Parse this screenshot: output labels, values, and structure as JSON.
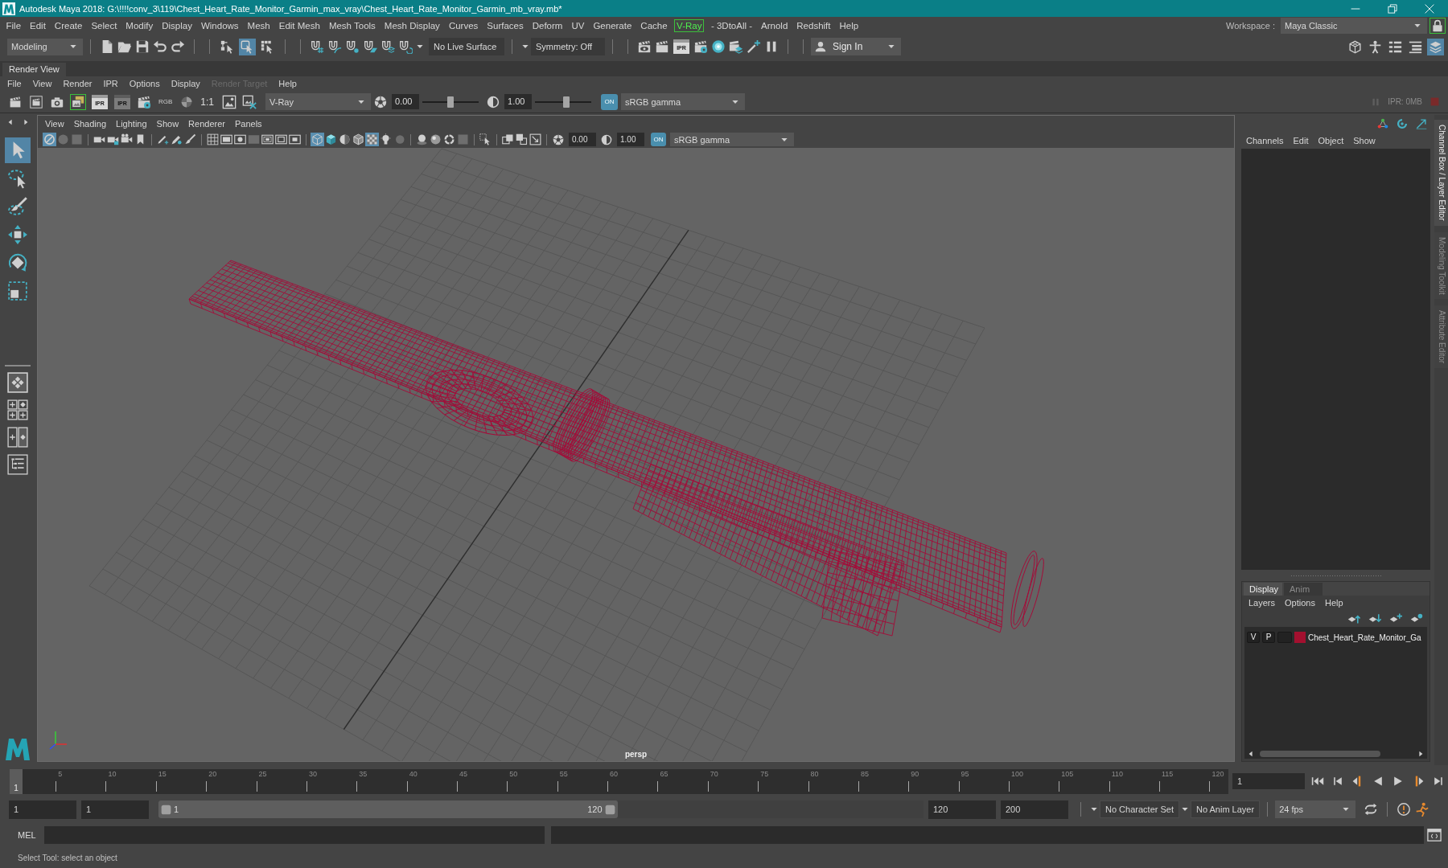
{
  "window": {
    "title": "Autodesk Maya 2018: G:\\!!!!conv_3\\119\\Chest_Heart_Rate_Monitor_Garmin_max_vray\\Chest_Heart_Rate_Monitor_Garmin_mb_vray.mb*"
  },
  "main_menu": [
    {
      "label": "File",
      "highlighted": false
    },
    {
      "label": "Edit",
      "highlighted": false
    },
    {
      "label": "Create",
      "highlighted": false
    },
    {
      "label": "Select",
      "highlighted": false
    },
    {
      "label": "Modify",
      "highlighted": false
    },
    {
      "label": "Display",
      "highlighted": false
    },
    {
      "label": "Windows",
      "highlighted": false
    },
    {
      "label": "Mesh",
      "highlighted": false
    },
    {
      "label": "Edit Mesh",
      "highlighted": false
    },
    {
      "label": "Mesh Tools",
      "highlighted": false
    },
    {
      "label": "Mesh Display",
      "highlighted": false
    },
    {
      "label": "Curves",
      "highlighted": false
    },
    {
      "label": "Surfaces",
      "highlighted": false
    },
    {
      "label": "Deform",
      "highlighted": false
    },
    {
      "label": "UV",
      "highlighted": false
    },
    {
      "label": "Generate",
      "highlighted": false
    },
    {
      "label": "Cache",
      "highlighted": false
    },
    {
      "label": "V-Ray",
      "highlighted": true
    },
    {
      "label": "- 3DtoAll -",
      "highlighted": false
    },
    {
      "label": "Arnold",
      "highlighted": false
    },
    {
      "label": "Redshift",
      "highlighted": false
    },
    {
      "label": "Help",
      "highlighted": false
    }
  ],
  "workspace": {
    "label": "Workspace :",
    "value": "Maya Classic",
    "locked": true
  },
  "status_line": {
    "menu_set": "Modeling",
    "selection_modes": [
      {
        "selected": false
      },
      {
        "selected": true
      },
      {
        "selected": false
      }
    ],
    "live_surface": "No Live Surface",
    "symmetry": "Symmetry: Off",
    "ipr_label": "IPR",
    "sign_in": "Sign In",
    "panel_toggles": [
      {
        "on": false
      },
      {
        "on": false
      },
      {
        "on": false
      },
      {
        "on": false
      },
      {
        "on": true
      }
    ]
  },
  "render_view": {
    "tab": "Render View",
    "menu": [
      {
        "label": "File",
        "disabled": false
      },
      {
        "label": "View",
        "disabled": false
      },
      {
        "label": "Render",
        "disabled": false
      },
      {
        "label": "IPR",
        "disabled": false
      },
      {
        "label": "Options",
        "disabled": false
      },
      {
        "label": "Display",
        "disabled": false
      },
      {
        "label": "Render Target",
        "disabled": true
      },
      {
        "label": "Help",
        "disabled": false
      }
    ],
    "toggles": [
      {
        "on": false
      },
      {
        "on": false
      },
      {
        "on": false
      },
      {
        "on": true
      }
    ],
    "ipr_buttons": [
      {
        "label": "IPR",
        "disabled": false
      },
      {
        "label": "IPR",
        "disabled": true
      }
    ],
    "channel_label": "RGB",
    "zoom_label": "1:1",
    "renderer": "V-Ray",
    "exposure": {
      "value": "0.00",
      "level": 0.5
    },
    "gamma": {
      "value": "1.00",
      "level": 0.55
    },
    "view_transform_label": "ON",
    "view_transform": "sRGB gamma",
    "ipr_memory": "IPR: 0MB"
  },
  "tool_box": {
    "tools": [
      {
        "selected": true
      },
      {
        "selected": false
      },
      {
        "selected": false
      },
      {
        "selected": false
      },
      {
        "selected": false
      },
      {
        "selected": false
      }
    ]
  },
  "viewport": {
    "menu": [
      "View",
      "Shading",
      "Lighting",
      "Show",
      "Renderer",
      "Panels"
    ],
    "toggles": [
      {
        "on": true,
        "disabled": false
      },
      {
        "on": false,
        "disabled": true
      },
      {
        "on": false,
        "disabled": true
      },
      {
        "on": false,
        "disabled": false
      },
      {
        "on": false,
        "disabled": false
      },
      {
        "on": false,
        "disabled": false
      },
      {
        "on": false,
        "disabled": false
      },
      {
        "on": false,
        "disabled": false
      },
      {
        "on": false,
        "disabled": false
      },
      {
        "on": false,
        "disabled": false
      },
      {
        "on": false,
        "disabled": false
      },
      {
        "on": false,
        "disabled": false
      },
      {
        "on": false,
        "disabled": false
      },
      {
        "on": false,
        "disabled": true
      },
      {
        "on": false,
        "disabled": false
      },
      {
        "on": false,
        "disabled": false
      },
      {
        "on": false,
        "disabled": false
      },
      {
        "on": true,
        "disabled": false
      },
      {
        "on": false,
        "disabled": false
      },
      {
        "on": false,
        "disabled": false
      },
      {
        "on": false,
        "disabled": false
      },
      {
        "on": true,
        "disabled": false
      },
      {
        "on": false,
        "disabled": false
      },
      {
        "on": false,
        "disabled": true
      },
      {
        "on": false,
        "disabled": false
      },
      {
        "on": false,
        "disabled": false
      },
      {
        "on": false,
        "disabled": false
      },
      {
        "on": false,
        "disabled": true
      },
      {
        "on": false,
        "disabled": false
      },
      {
        "on": false,
        "disabled": false
      },
      {
        "on": false,
        "disabled": false
      },
      {
        "on": false,
        "disabled": false
      }
    ],
    "exposure": "0.00",
    "gamma": "1.00",
    "view_transform_label": "ON",
    "view_transform": "sRGB gamma",
    "camera": "persp"
  },
  "channel_box": {
    "menu": [
      "Channels",
      "Edit",
      "Object",
      "Show"
    ]
  },
  "layer_editor": {
    "tabs": [
      {
        "label": "Display",
        "selected": true
      },
      {
        "label": "Anim",
        "selected": false
      }
    ],
    "menu": [
      "Layers",
      "Options",
      "Help"
    ],
    "layers": [
      {
        "visibility": "V",
        "playback": "P",
        "color": "#a3102f",
        "name": "Chest_Heart_Rate_Monitor_Ga"
      }
    ]
  },
  "side_tabs": [
    {
      "label": "Channel Box / Layer Editor",
      "selected": true
    },
    {
      "label": "Modeling Toolkit",
      "selected": false
    },
    {
      "label": "Attribute Editor",
      "selected": false
    }
  ],
  "time_slider": {
    "current_frame": "1",
    "level": 0,
    "tick_labels": [
      "5",
      "10",
      "15",
      "20",
      "25",
      "30",
      "35",
      "40",
      "45",
      "50",
      "55",
      "60",
      "65",
      "70",
      "75",
      "80",
      "85",
      "90",
      "95",
      "100",
      "105",
      "110",
      "115",
      "120"
    ],
    "frame_field": "1"
  },
  "range_slider": {
    "animation_start": "1",
    "playback_start": "1",
    "range_start": "1",
    "range_end": "120",
    "level": 0.6,
    "playback_end": "120",
    "animation_end": "200",
    "character_set": "No Character Set",
    "anim_layer": "No Anim Layer",
    "fps": "24 fps"
  },
  "command_line": {
    "language": "MEL"
  },
  "help_line": "Select Tool: select an object"
}
